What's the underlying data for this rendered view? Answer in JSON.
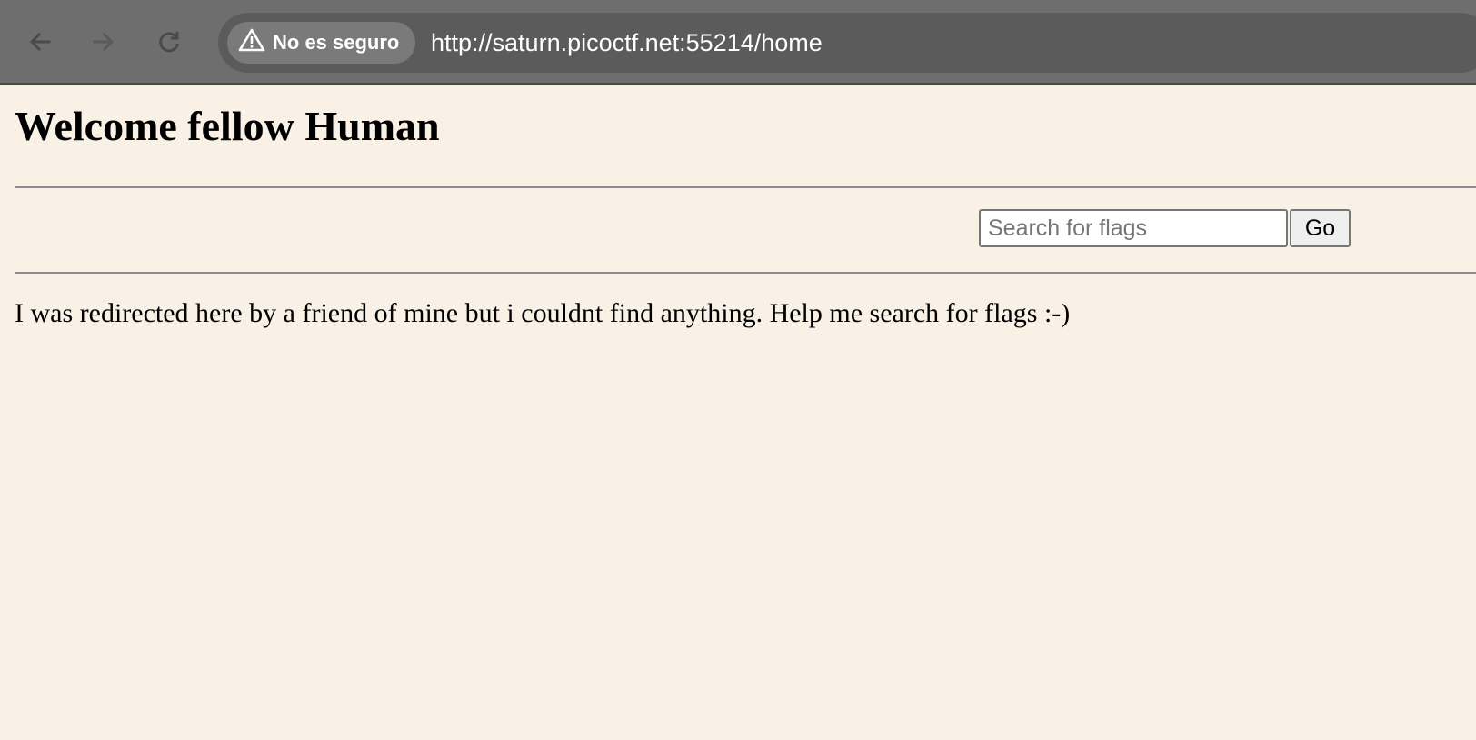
{
  "browser": {
    "back_icon": "arrow-left-icon",
    "forward_icon": "arrow-right-icon",
    "reload_icon": "reload-icon",
    "security_icon": "warning-triangle-icon",
    "security_label": "No es seguro",
    "url": "http://saturn.picoctf.net:55214/home"
  },
  "page": {
    "title": "Welcome fellow Human",
    "search": {
      "placeholder": "Search for flags",
      "value": "",
      "button_label": "Go"
    },
    "message": "I was redirected here by a friend of mine but i couldnt find anything. Help me search for flags :-)"
  },
  "colors": {
    "page_background": "#f9f0e6",
    "browser_bar": "#6e6e6e",
    "omnibox": "#5b5b5b"
  }
}
